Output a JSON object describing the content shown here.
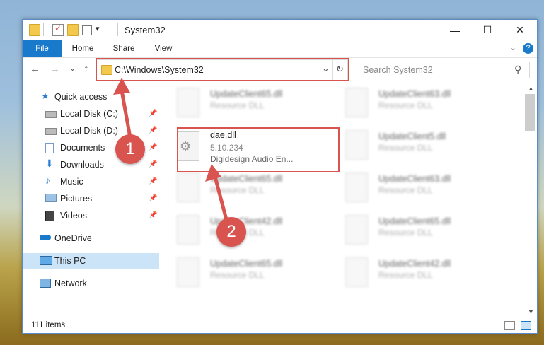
{
  "window": {
    "title": "System32",
    "controls": {
      "minimize": "—",
      "maximize": "☐",
      "close": "✕"
    }
  },
  "ribbon": {
    "tabs": [
      "File",
      "Home",
      "Share",
      "View"
    ],
    "help": "?",
    "expand": "⌄"
  },
  "nav": {
    "back": "←",
    "forward": "→",
    "recent": "⌄",
    "up": "↑",
    "address": "C:\\Windows\\System32",
    "address_dropdown": "⌄",
    "refresh": "↻",
    "search_placeholder": "Search System32",
    "search_icon": "⚲"
  },
  "sidebar": {
    "items": [
      {
        "label": "Quick access",
        "icon": "star-icon",
        "pinned": false
      },
      {
        "label": "Local Disk (C:)",
        "icon": "drive-icon",
        "pinned": true
      },
      {
        "label": "Local Disk (D:)",
        "icon": "drive-icon",
        "pinned": true
      },
      {
        "label": "Documents",
        "icon": "documents-icon",
        "pinned": true
      },
      {
        "label": "Downloads",
        "icon": "downloads-icon",
        "pinned": true
      },
      {
        "label": "Music",
        "icon": "music-icon",
        "pinned": true
      },
      {
        "label": "Pictures",
        "icon": "pictures-icon",
        "pinned": true
      },
      {
        "label": "Videos",
        "icon": "videos-icon",
        "pinned": true
      },
      {
        "label": "OneDrive",
        "icon": "cloud-icon",
        "pinned": false
      },
      {
        "label": "This PC",
        "icon": "computer-icon",
        "pinned": false
      },
      {
        "label": "Network",
        "icon": "network-icon",
        "pinned": false
      }
    ],
    "pin_glyph": "📌"
  },
  "files": {
    "highlight": {
      "name": "dae.dll",
      "version": "5.10.234",
      "description": "Digidesign Audio En..."
    },
    "blurred": [
      {
        "name": "UpdateClient65.dll",
        "type": "Resource DLL"
      },
      {
        "name": "UpdateClient63.dll",
        "type": "Resource DLL"
      },
      {
        "name": "UpdateClient5.dll",
        "type": "Resource DLL"
      },
      {
        "name": "UpdateClient65.dll",
        "type": "Resource DLL"
      },
      {
        "name": "UpdateClient63.dll",
        "type": "Resource DLL"
      },
      {
        "name": "UpdateClient42.dll",
        "type": "Resource DLL"
      },
      {
        "name": "UpdateClient65.dll",
        "type": "Resource DLL"
      },
      {
        "name": "UpdateClient65.dll",
        "type": "Resource DLL"
      },
      {
        "name": "UpdateClient42.dll",
        "type": "Resource DLL"
      }
    ]
  },
  "status": {
    "item_count": "111 items"
  },
  "annotations": {
    "step1": "1",
    "step2": "2"
  },
  "colors": {
    "accent": "#1979ca",
    "highlight": "#d9534f",
    "selected": "#cce4f7"
  }
}
